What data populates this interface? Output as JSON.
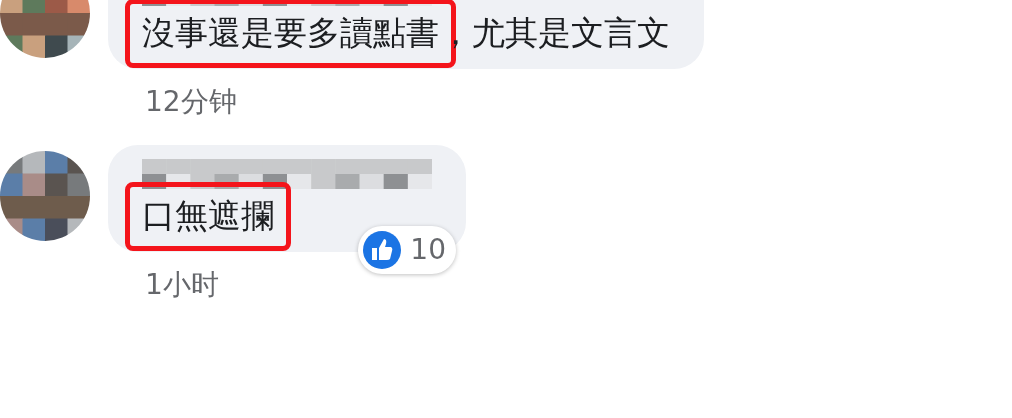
{
  "comments": [
    {
      "parts": [
        {
          "text": "沒事還是要多讀點書",
          "highlighted": true
        },
        {
          "text": "，尤其是文言文",
          "highlighted": false
        }
      ],
      "time": "12分钟"
    },
    {
      "parts": [
        {
          "text": "口無遮攔",
          "highlighted": true
        }
      ],
      "reaction_count": "10",
      "time": "1小时"
    }
  ]
}
